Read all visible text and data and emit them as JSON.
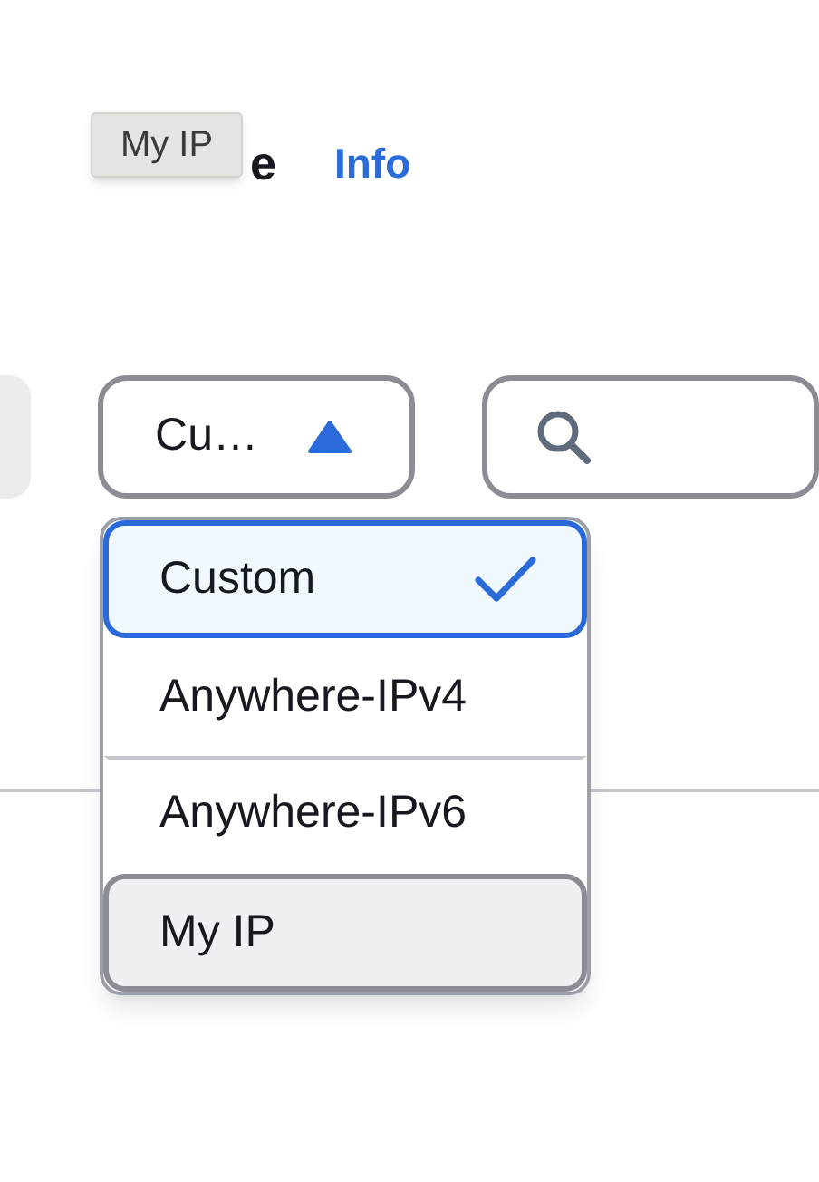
{
  "tooltip": {
    "text": "My IP"
  },
  "heading": {
    "text": "e"
  },
  "info_link": {
    "text": "Info"
  },
  "filter_select": {
    "value": "Cu…",
    "expanded": true
  },
  "options": [
    {
      "label": "Custom",
      "selected": true,
      "hovered": false
    },
    {
      "label": "Anywhere-IPv4",
      "selected": false,
      "hovered": false
    },
    {
      "label": "Anywhere-IPv6",
      "selected": false,
      "hovered": false
    },
    {
      "label": "My IP",
      "selected": false,
      "hovered": true
    }
  ]
}
